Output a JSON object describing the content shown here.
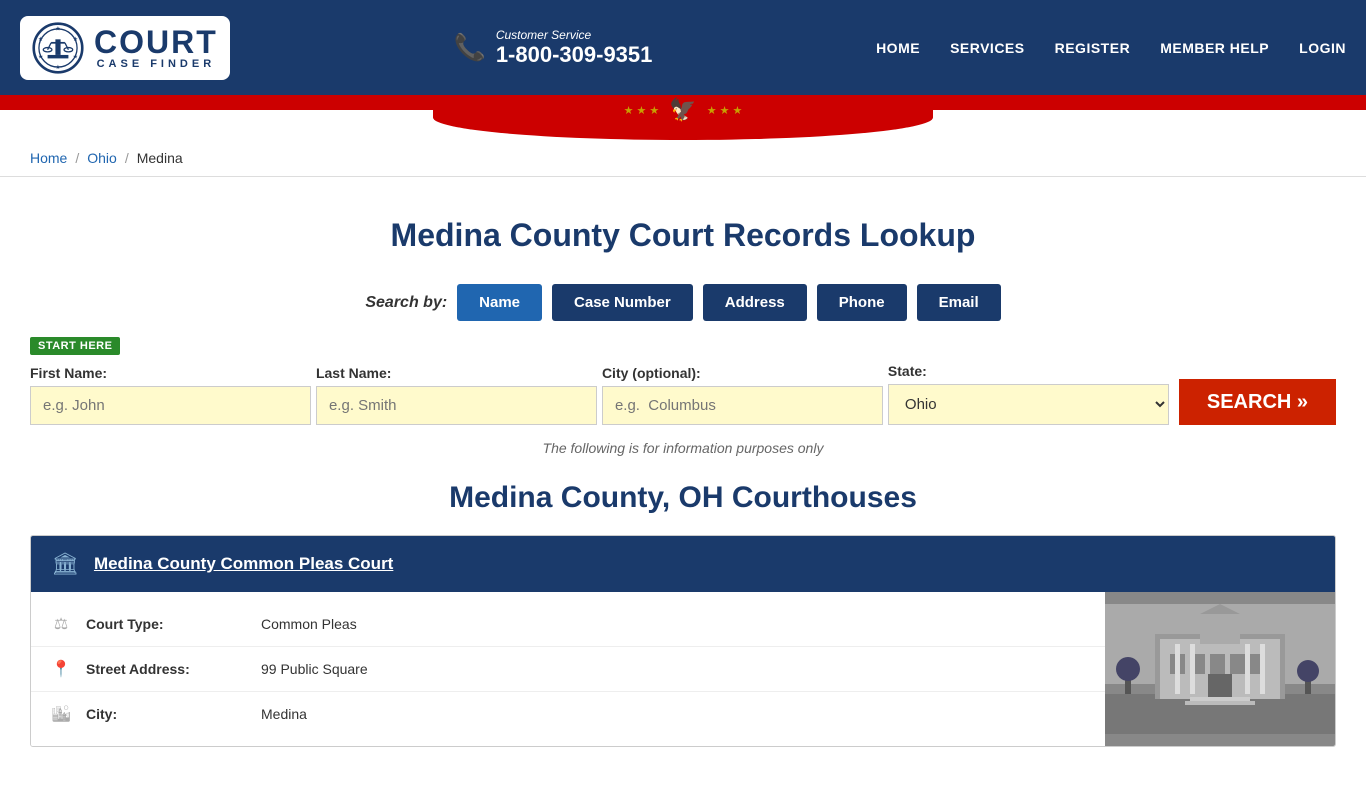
{
  "header": {
    "logo": {
      "court_text": "COURT",
      "case_finder_text": "CASE FINDER"
    },
    "phone": {
      "customer_service_label": "Customer Service",
      "number": "1-800-309-9351"
    },
    "nav": {
      "items": [
        {
          "label": "HOME",
          "href": "#"
        },
        {
          "label": "SERVICES",
          "href": "#"
        },
        {
          "label": "REGISTER",
          "href": "#"
        },
        {
          "label": "MEMBER HELP",
          "href": "#"
        },
        {
          "label": "LOGIN",
          "href": "#"
        }
      ]
    }
  },
  "breadcrumb": {
    "items": [
      {
        "label": "Home",
        "href": "#"
      },
      {
        "label": "Ohio",
        "href": "#"
      },
      {
        "label": "Medina",
        "href": null
      }
    ]
  },
  "main": {
    "page_title": "Medina County Court Records Lookup",
    "search_by_label": "Search by:",
    "search_tabs": [
      {
        "label": "Name",
        "active": true
      },
      {
        "label": "Case Number",
        "active": false
      },
      {
        "label": "Address",
        "active": false
      },
      {
        "label": "Phone",
        "active": false
      },
      {
        "label": "Email",
        "active": false
      }
    ],
    "start_here_badge": "START HERE",
    "form": {
      "first_name_label": "First Name:",
      "first_name_placeholder": "e.g. John",
      "last_name_label": "Last Name:",
      "last_name_placeholder": "e.g. Smith",
      "city_label": "City (optional):",
      "city_placeholder": "e.g.  Columbus",
      "state_label": "State:",
      "state_value": "Ohio",
      "search_button": "SEARCH »"
    },
    "info_note": "The following is for information purposes only",
    "courthouses_title": "Medina County, OH Courthouses",
    "courthouses": [
      {
        "name": "Medina County Common Pleas Court",
        "href": "#",
        "details": [
          {
            "icon": "⚖",
            "label": "Court Type:",
            "value": "Common Pleas"
          },
          {
            "icon": "📍",
            "label": "Street Address:",
            "value": "99 Public Square"
          },
          {
            "icon": "🏙",
            "label": "City:",
            "value": "Medina"
          }
        ]
      }
    ]
  }
}
